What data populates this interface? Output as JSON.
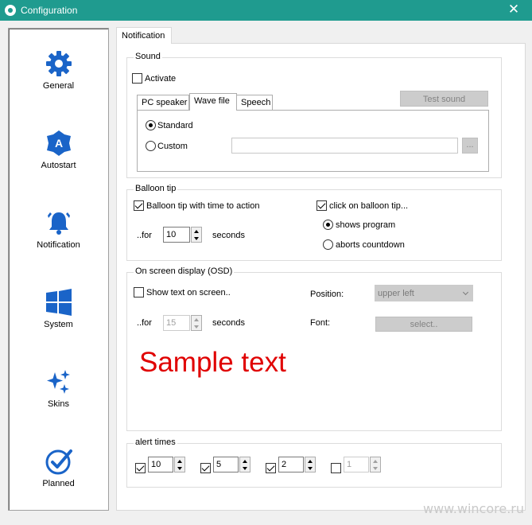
{
  "window": {
    "title": "Configuration",
    "close_glyph": "✕",
    "accent": "#1f9b8f"
  },
  "sidebar": {
    "items": [
      {
        "label": "General",
        "icon": "gear-icon"
      },
      {
        "label": "Autostart",
        "icon": "autostart-icon"
      },
      {
        "label": "Notification",
        "icon": "bell-icon"
      },
      {
        "label": "System",
        "icon": "windows-icon"
      },
      {
        "label": "Skins",
        "icon": "sparkles-icon"
      },
      {
        "label": "Planned",
        "icon": "check-circle-icon"
      }
    ],
    "icon_color": "#1a64c8"
  },
  "main_tab": "Notification",
  "sound": {
    "title": "Sound",
    "activate_label": "Activate",
    "activate_checked": false,
    "tabs": [
      "PC speaker",
      "Wave file",
      "Speech"
    ],
    "selected_tab": "Wave file",
    "test_button": "Test sound",
    "standard_label": "Standard",
    "custom_label": "Custom",
    "custom_value": "",
    "browse_button": "..."
  },
  "balloon": {
    "title": "Balloon tip",
    "with_time_label": "Balloon tip with time to action",
    "with_time_checked": true,
    "for_label": "..for",
    "for_value": "10",
    "seconds_label": "seconds",
    "click_label": "click on balloon tip...",
    "click_checked": true,
    "shows_program_label": "shows program",
    "aborts_countdown_label": "aborts countdown",
    "selected_option": "shows program"
  },
  "osd": {
    "title": "On screen display (OSD)",
    "show_text_label": "Show text on screen..",
    "show_text_checked": false,
    "for_label": "..for",
    "for_value": "15",
    "seconds_label": "seconds",
    "position_label": "Position:",
    "position_value": "upper left",
    "font_label": "Font:",
    "font_button": "select..",
    "sample_text": "Sample text",
    "sample_color": "#e00000"
  },
  "alert_times": {
    "title": "alert times",
    "items": [
      {
        "value": "10",
        "checked": true
      },
      {
        "value": "5",
        "checked": true
      },
      {
        "value": "2",
        "checked": true
      },
      {
        "value": "1",
        "checked": false
      }
    ]
  },
  "watermark": "www.wincore.ru"
}
